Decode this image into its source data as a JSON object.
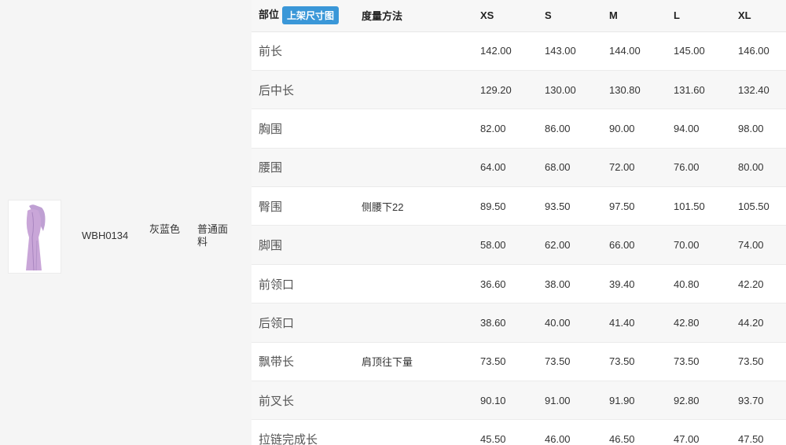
{
  "product": {
    "sku": "WBH0134",
    "color": "灰蓝色",
    "fabric": "普通面料",
    "image_icon": "dress-thumbnail-icon"
  },
  "size_table": {
    "headers": {
      "part": "部位",
      "upload_button": "上架尺寸图",
      "method": "度量方法",
      "sizes": [
        "XS",
        "S",
        "M",
        "L",
        "XL"
      ]
    },
    "rows": [
      {
        "part": "前长",
        "method": "",
        "values": [
          "142.00",
          "143.00",
          "144.00",
          "145.00",
          "146.00"
        ]
      },
      {
        "part": "后中长",
        "method": "",
        "values": [
          "129.20",
          "130.00",
          "130.80",
          "131.60",
          "132.40"
        ]
      },
      {
        "part": "胸围",
        "method": "",
        "values": [
          "82.00",
          "86.00",
          "90.00",
          "94.00",
          "98.00"
        ]
      },
      {
        "part": "腰围",
        "method": "",
        "values": [
          "64.00",
          "68.00",
          "72.00",
          "76.00",
          "80.00"
        ]
      },
      {
        "part": "臀围",
        "method": "侧腰下22",
        "values": [
          "89.50",
          "93.50",
          "97.50",
          "101.50",
          "105.50"
        ]
      },
      {
        "part": "脚围",
        "method": "",
        "values": [
          "58.00",
          "62.00",
          "66.00",
          "70.00",
          "74.00"
        ]
      },
      {
        "part": "前领口",
        "method": "",
        "values": [
          "36.60",
          "38.00",
          "39.40",
          "40.80",
          "42.20"
        ]
      },
      {
        "part": "后领口",
        "method": "",
        "values": [
          "38.60",
          "40.00",
          "41.40",
          "42.80",
          "44.20"
        ]
      },
      {
        "part": "飘带长",
        "method": "肩顶往下量",
        "values": [
          "73.50",
          "73.50",
          "73.50",
          "73.50",
          "73.50"
        ]
      },
      {
        "part": "前叉长",
        "method": "",
        "values": [
          "90.10",
          "91.00",
          "91.90",
          "92.80",
          "93.70"
        ]
      },
      {
        "part": "拉链完成长",
        "method": "",
        "values": [
          "45.50",
          "46.00",
          "46.50",
          "47.00",
          "47.50"
        ]
      }
    ]
  },
  "colors": {
    "accent": "#3a97d8",
    "dress": "#c9a6d8"
  }
}
